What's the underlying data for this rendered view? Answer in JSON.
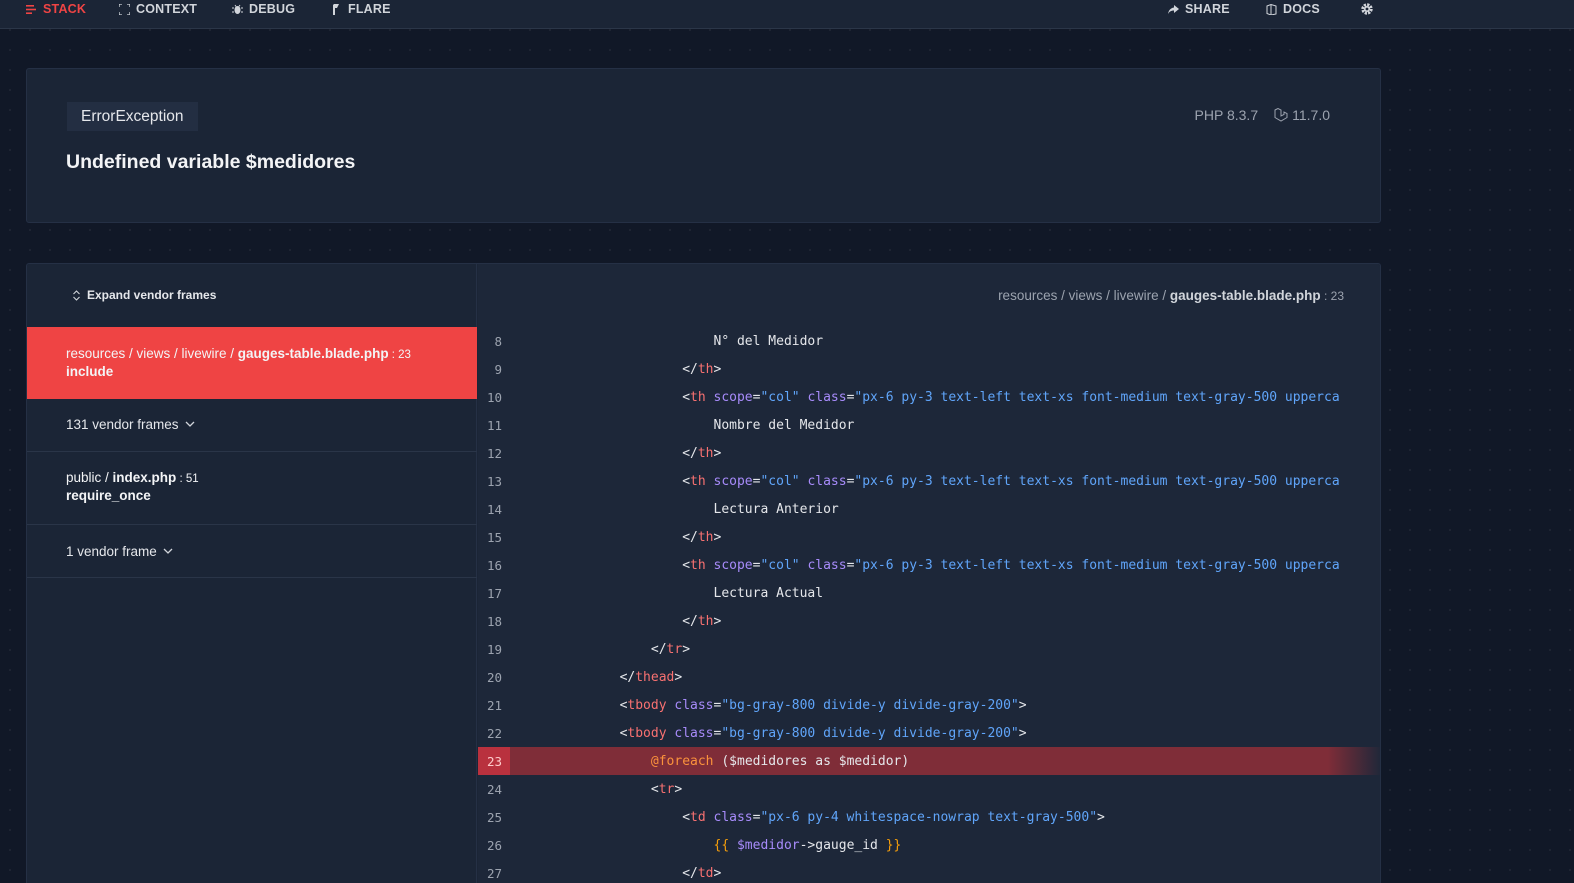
{
  "nav": {
    "left": [
      {
        "label": "STACK",
        "icon": "stack-icon",
        "active": true
      },
      {
        "label": "CONTEXT",
        "icon": "context-icon"
      },
      {
        "label": "DEBUG",
        "icon": "debug-icon"
      },
      {
        "label": "FLARE",
        "icon": "flare-icon"
      }
    ],
    "right": [
      {
        "label": "SHARE",
        "icon": "share-icon"
      },
      {
        "label": "DOCS",
        "icon": "docs-icon"
      }
    ],
    "settings_icon": "gear-icon"
  },
  "header": {
    "exception_class": "ErrorException",
    "message": "Undefined variable $medidores",
    "php_version": "PHP 8.3.7",
    "laravel_version": "11.7.0"
  },
  "frames": {
    "expand_label": "Expand vendor frames",
    "items": [
      {
        "path_prefix": "resources / views / livewire / ",
        "file": "gauges-table.blade.php",
        "line": " : 23",
        "function": "include",
        "selected": true
      },
      {
        "vendor_label": "131 vendor frames"
      },
      {
        "path_prefix": "public / ",
        "file": "index.php",
        "line": " : 51",
        "function": "require_once"
      },
      {
        "vendor_label": "1 vendor frame"
      }
    ]
  },
  "code": {
    "path_prefix": "resources / views / livewire / ",
    "file": "gauges-table.blade.php",
    "line": " : 23",
    "highlight_line": 23,
    "lines": [
      {
        "n": "8"
      },
      {
        "n": "9"
      },
      {
        "n": "10"
      },
      {
        "n": "11"
      },
      {
        "n": "12"
      },
      {
        "n": "13"
      },
      {
        "n": "14"
      },
      {
        "n": "15"
      },
      {
        "n": "16"
      },
      {
        "n": "17"
      },
      {
        "n": "18"
      },
      {
        "n": "19"
      },
      {
        "n": "20"
      },
      {
        "n": "21"
      },
      {
        "n": "22"
      },
      {
        "n": "23"
      },
      {
        "n": "24"
      },
      {
        "n": "25"
      },
      {
        "n": "26"
      },
      {
        "n": "27"
      }
    ],
    "text": {
      "l8": "N° del Medidor",
      "l11": "Nombre del Medidor",
      "l14": "Lectura Anterior",
      "l17": "Lectura Actual",
      "th_class": "\"px-6 py-3 text-left text-xs font-medium text-gray-500 upperca",
      "th_scope": "\"col\"",
      "tbody_class": "\"bg-gray-800 divide-y divide-gray-200\"",
      "foreach_kw": "@foreach",
      "foreach_rest": " ($medidores as $medidor)",
      "td_class": "\"px-6 py-4 whitespace-nowrap text-gray-500\"",
      "echo_var": "$medidor",
      "echo_prop": "->gauge_id "
    }
  },
  "colors": {
    "accent": "#ef4444",
    "background": "#111827",
    "panel": "#1b2536",
    "highlight_row": "#7f2d38"
  }
}
